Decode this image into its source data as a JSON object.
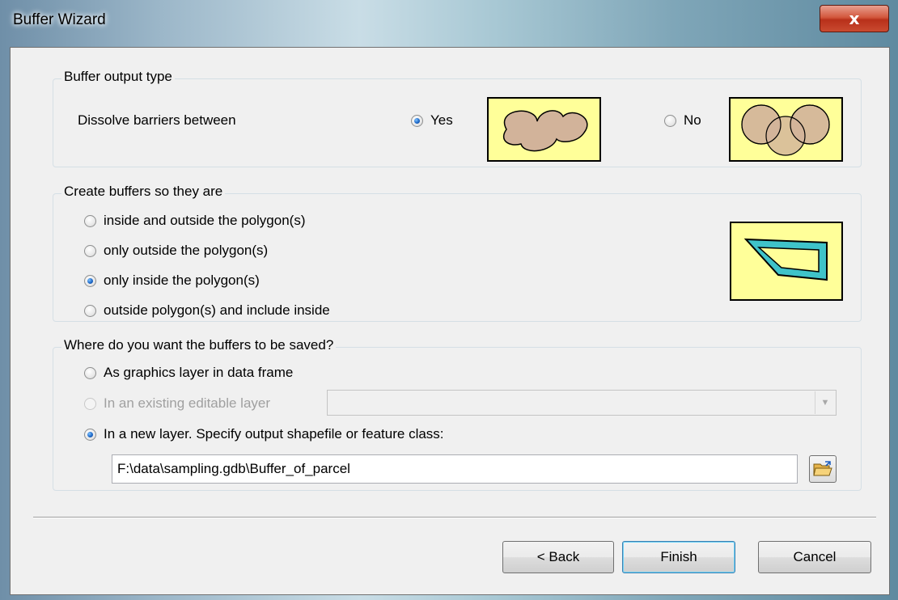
{
  "window": {
    "title": "Buffer Wizard",
    "close_glyph": "x"
  },
  "output_type": {
    "legend": "Buffer output type",
    "dissolve_label": "Dissolve barriers between",
    "yes_label": "Yes",
    "no_label": "No",
    "selected": "Yes"
  },
  "create_buffers": {
    "legend": "Create buffers so they are",
    "options": [
      {
        "label": "inside and outside the polygon(s)",
        "checked": false
      },
      {
        "label": "only outside the polygon(s)",
        "checked": false
      },
      {
        "label": "only inside the polygon(s)",
        "checked": true
      },
      {
        "label": "outside polygon(s) and include inside",
        "checked": false
      }
    ]
  },
  "save_location": {
    "legend": "Where do you want the buffers to be saved?",
    "graphics_label": "As graphics layer in data frame",
    "existing_label": "In an existing editable layer",
    "existing_value": "",
    "new_layer_label": "In a new layer.  Specify output shapefile or feature class:",
    "output_path": "F:\\data\\sampling.gdb\\Buffer_of_parcel"
  },
  "buttons": {
    "back": "< Back",
    "finish": "Finish",
    "cancel": "Cancel"
  },
  "colors": {
    "preview_fill": "#ffff99",
    "buffer_fill": "#d2b39a",
    "inside_buffer": "#3fc3c9"
  },
  "icons": {
    "browse": "folder-open-icon",
    "close": "close-icon",
    "dropdown": "chevron-down-icon"
  }
}
